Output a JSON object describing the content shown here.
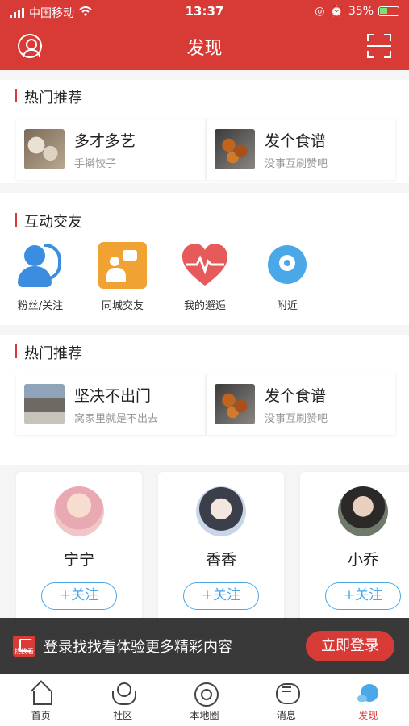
{
  "status_bar": {
    "carrier": "中国移动",
    "time": "13:37",
    "battery": "35%",
    "battery_level": 0.35
  },
  "navbar": {
    "title": "发现"
  },
  "hot_section_1": {
    "title": "热门推荐",
    "items": [
      {
        "title": "多才多艺",
        "subtitle": "手擀饺子"
      },
      {
        "title": "发个食谱",
        "subtitle": "没事互刷赞吧"
      }
    ]
  },
  "social_section": {
    "title": "互动交友",
    "items": [
      {
        "label": "粉丝/关注"
      },
      {
        "label": "同城交友"
      },
      {
        "label": "我的邂逅"
      },
      {
        "label": "附近"
      }
    ]
  },
  "hot_section_2": {
    "title": "热门推荐",
    "items": [
      {
        "title": "坚决不出门",
        "subtitle": "窝家里就是不出去"
      },
      {
        "title": "发个食谱",
        "subtitle": "没事互刷赞吧"
      }
    ]
  },
  "users": [
    {
      "name": "宁宁",
      "follow_label": "+关注",
      "avatar_color": "#f2c6c6"
    },
    {
      "name": "香香",
      "follow_label": "+关注",
      "avatar_color": "#c9d6e8"
    },
    {
      "name": "小乔",
      "follow_label": "+关注",
      "avatar_color": "#6f7a6a"
    }
  ],
  "login_banner": {
    "logo_text": "找找看",
    "text": "登录找找看体验更多精彩内容",
    "button_label": "立即登录"
  },
  "tabbar": [
    {
      "label": "首页",
      "icon": "home-icon",
      "active": false
    },
    {
      "label": "社区",
      "icon": "community-icon",
      "active": false
    },
    {
      "label": "本地圈",
      "icon": "map-icon",
      "active": false
    },
    {
      "label": "消息",
      "icon": "message-icon",
      "active": false
    },
    {
      "label": "发现",
      "icon": "discover-icon",
      "active": true
    }
  ],
  "colors": {
    "brand": "#d83a36",
    "accent_blue": "#4aa8e8",
    "orange": "#f0a232"
  }
}
